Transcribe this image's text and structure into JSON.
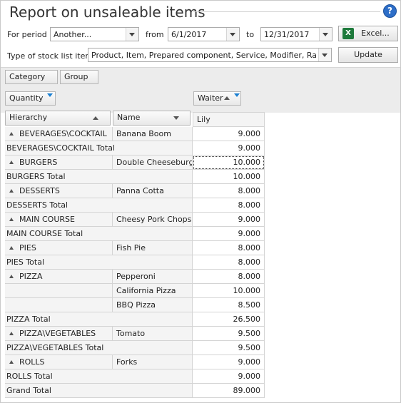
{
  "title": "Report on unsaleable items",
  "help_label": "?",
  "filters": {
    "period_label": "For period",
    "period_value": "Another...",
    "from_label": "from",
    "from_value": "6/1/2017",
    "to_label": "to",
    "to_value": "12/31/2017",
    "excel_label": "Excel...",
    "type_label": "Type of stock list item:",
    "type_value": "Product, Item, Prepared component, Service, Modifier, Rate",
    "update_label": "Update"
  },
  "pivot": {
    "filter_fields": [
      "Category",
      "Group"
    ],
    "data_field": "Quantity",
    "column_field": "Waiter",
    "row_fields": [
      "Hierarchy",
      "Name"
    ],
    "column_value": "Lily"
  },
  "rows": [
    {
      "hierarchy": "BEVERAGES\\COCKTAIL",
      "name": "Banana Boom",
      "value": "9.000",
      "kind": "group"
    },
    {
      "hierarchy": "BEVERAGES\\COCKTAIL Total",
      "name": "",
      "value": "9.000",
      "kind": "total"
    },
    {
      "hierarchy": "BURGERS",
      "name": "Double Cheeseburger",
      "value": "10.000",
      "kind": "group"
    },
    {
      "hierarchy": "BURGERS Total",
      "name": "",
      "value": "10.000",
      "kind": "total"
    },
    {
      "hierarchy": "DESSERTS",
      "name": "Panna Cotta",
      "value": "8.000",
      "kind": "group"
    },
    {
      "hierarchy": "DESSERTS Total",
      "name": "",
      "value": "8.000",
      "kind": "total"
    },
    {
      "hierarchy": "MAIN COURSE",
      "name": "Cheesy Pork Chops",
      "value": "9.000",
      "kind": "group"
    },
    {
      "hierarchy": "MAIN COURSE Total",
      "name": "",
      "value": "9.000",
      "kind": "total"
    },
    {
      "hierarchy": "PIES",
      "name": "Fish Pie",
      "value": "8.000",
      "kind": "group"
    },
    {
      "hierarchy": "PIES Total",
      "name": "",
      "value": "8.000",
      "kind": "total"
    },
    {
      "hierarchy": "PIZZA",
      "name": "Pepperoni",
      "value": "8.000",
      "kind": "group"
    },
    {
      "hierarchy": "",
      "name": "California Pizza",
      "value": "10.000",
      "kind": "item"
    },
    {
      "hierarchy": "",
      "name": "BBQ Pizza",
      "value": "8.500",
      "kind": "item"
    },
    {
      "hierarchy": "PIZZA Total",
      "name": "",
      "value": "26.500",
      "kind": "total"
    },
    {
      "hierarchy": "PIZZA\\VEGETABLES",
      "name": "Tomato",
      "value": "9.500",
      "kind": "group"
    },
    {
      "hierarchy": "PIZZA\\VEGETABLES Total",
      "name": "",
      "value": "9.500",
      "kind": "total"
    },
    {
      "hierarchy": "ROLLS",
      "name": "Forks",
      "value": "9.000",
      "kind": "group"
    },
    {
      "hierarchy": "ROLLS Total",
      "name": "",
      "value": "9.000",
      "kind": "total"
    },
    {
      "hierarchy": "Grand Total",
      "name": "",
      "value": "89.000",
      "kind": "total"
    }
  ]
}
